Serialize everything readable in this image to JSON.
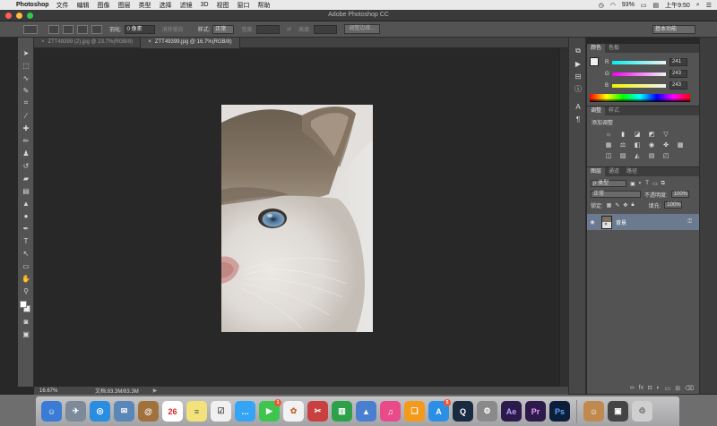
{
  "menubar": {
    "app": "Photoshop",
    "items": [
      "文件",
      "编辑",
      "图像",
      "图层",
      "类型",
      "选择",
      "滤镜",
      "3D",
      "视图",
      "窗口",
      "帮助"
    ],
    "battery": "93%",
    "clock": "上午9:50"
  },
  "window": {
    "title": "Adobe Photoshop CC"
  },
  "options": {
    "feather_label": "羽化:",
    "feather_value": "0 像素",
    "antialias": "消除锯齿",
    "style_label": "样式:",
    "style_value": "正常",
    "width_label": "宽度:",
    "height_label": "高度:",
    "refine_button": "调整边缘...",
    "workspace": "基本功能"
  },
  "tabs": [
    {
      "label": "ZTT49399 (2).jpg @ 23.7%(RGB/8)"
    },
    {
      "label": "ZTT49399.jpg @ 16.7%(RGB/8)"
    }
  ],
  "status": {
    "zoom": "16.67%",
    "doc": "文档:83.3M/83.3M",
    "arrow": "▶"
  },
  "color_panel": {
    "tabs": [
      "颜色",
      "色板"
    ],
    "channels": [
      {
        "name": "R",
        "value": "241",
        "track": "linear-gradient(to right, #00f1f1, #f1f1f1)"
      },
      {
        "name": "G",
        "value": "243",
        "track": "linear-gradient(to right, #f100f1, #f1f3f1)"
      },
      {
        "name": "B",
        "value": "243",
        "track": "linear-gradient(to right, #f1f300, #f1f3f3)"
      }
    ]
  },
  "adjust_panel": {
    "tabs": [
      "调整",
      "样式"
    ],
    "title": "添加调整"
  },
  "layers_panel": {
    "tabs": [
      "图层",
      "通道",
      "路径"
    ],
    "kind_filter": "ρ 类型",
    "blend_mode": "正常",
    "opacity_label": "不透明度:",
    "opacity_value": "100%",
    "lock_label": "锁定:",
    "fill_label": "填充:",
    "fill_value": "100%",
    "layers": [
      {
        "name": "背景",
        "visible": true,
        "locked": true
      }
    ]
  },
  "dock": [
    {
      "name": "finder-icon",
      "color": "#3a7bd5",
      "glyph": "☺"
    },
    {
      "name": "launchpad-icon",
      "color": "#7d8a99",
      "glyph": "✈"
    },
    {
      "name": "safari-icon",
      "color": "#2a8ddf",
      "glyph": "◎"
    },
    {
      "name": "mail-icon",
      "color": "#5b86b8",
      "glyph": "✉"
    },
    {
      "name": "contacts-icon",
      "color": "#a0713a",
      "glyph": "@"
    },
    {
      "name": "calendar-icon",
      "color": "#ffffff",
      "glyph": "26",
      "text": "#d22"
    },
    {
      "name": "notes-icon",
      "color": "#f3e27a",
      "glyph": "≡",
      "text": "#555"
    },
    {
      "name": "reminders-icon",
      "color": "#f0f0f0",
      "glyph": "☑",
      "text": "#555"
    },
    {
      "name": "messages-icon",
      "color": "#35a4f5",
      "glyph": "…"
    },
    {
      "name": "facetime-icon",
      "color": "#3ec54e",
      "glyph": "▶",
      "badge": "1"
    },
    {
      "name": "photos-icon",
      "color": "#f2f2f2",
      "glyph": "✿",
      "text": "#c63"
    },
    {
      "name": "photobooth-icon",
      "color": "#c94040",
      "glyph": "✂"
    },
    {
      "name": "numbers-icon",
      "color": "#2fa04a",
      "glyph": "▥"
    },
    {
      "name": "keynote-icon",
      "color": "#4a7fd0",
      "glyph": "▲"
    },
    {
      "name": "itunes-icon",
      "color": "#e94b8a",
      "glyph": "♫"
    },
    {
      "name": "ibooks-icon",
      "color": "#f39a1c",
      "glyph": "❑"
    },
    {
      "name": "appstore-icon",
      "color": "#2b8fe6",
      "glyph": "A",
      "badge": "5"
    },
    {
      "name": "quicktime-icon",
      "color": "#1a2a40",
      "glyph": "Q"
    },
    {
      "name": "system-preferences-icon",
      "color": "#8a8a8a",
      "glyph": "⚙"
    },
    {
      "name": "after-effects-icon",
      "color": "#2b1a4a",
      "glyph": "Ae",
      "text": "#b9a2ff"
    },
    {
      "name": "premiere-icon",
      "color": "#2b1a4a",
      "glyph": "Pr",
      "text": "#e89bff"
    },
    {
      "name": "photoshop-icon",
      "color": "#0d1e3a",
      "glyph": "Ps",
      "text": "#53a7ff"
    },
    {
      "name": "downloads-icon",
      "color": "#c08a4e",
      "glyph": "☺"
    },
    {
      "name": "documents-icon",
      "color": "#444",
      "glyph": "▣"
    },
    {
      "name": "trash-icon",
      "color": "#cfcfcf",
      "glyph": "♲",
      "text": "#666"
    }
  ]
}
